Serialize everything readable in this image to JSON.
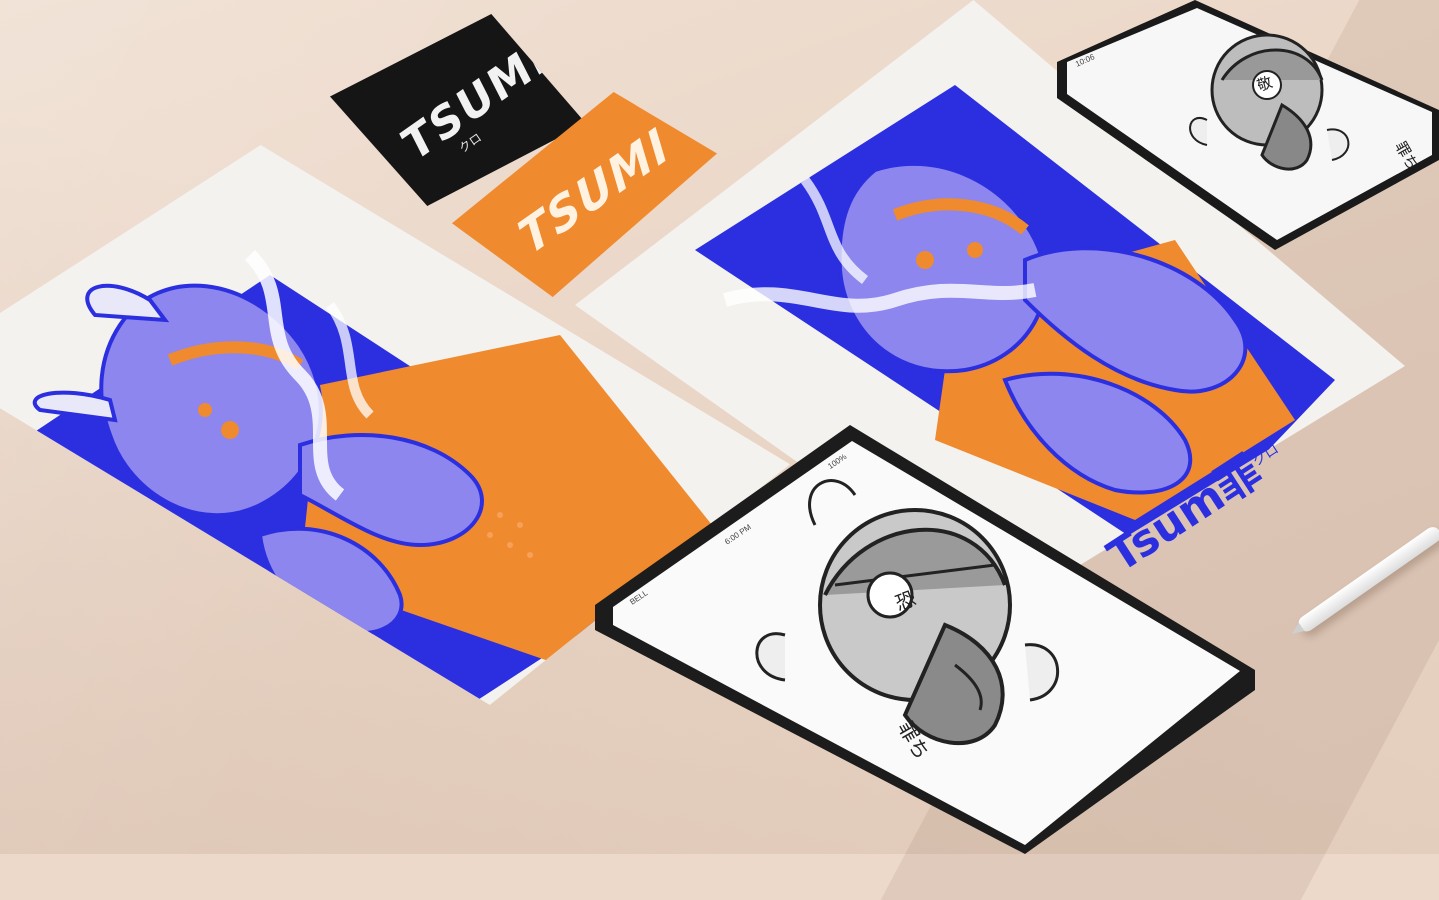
{
  "colors": {
    "background": "#ecd9ca",
    "blue": "#2b2fe0",
    "violet": "#7d79e6",
    "orange": "#f08a2e",
    "paper": "#f3f2ee",
    "black": "#151515"
  },
  "cards": {
    "black_logo": "TSUMI",
    "black_sub": "クロ",
    "orange_logo": "TSUMI"
  },
  "poster_right": {
    "wordmark": "Tsum罪",
    "wordmark_sub": "クロ"
  },
  "phone": {
    "time": "10:06",
    "kanji_badge": "敬",
    "kanji_signature": "罪ち"
  },
  "tablet": {
    "carrier": "BELL",
    "time": "6:00 PM",
    "battery": "100%",
    "kanji_badge": "恐",
    "kanji_signature": "罪ち"
  },
  "icons": {
    "poster": "oni-illustration-icon",
    "device_art": "oni-mask-icon"
  }
}
